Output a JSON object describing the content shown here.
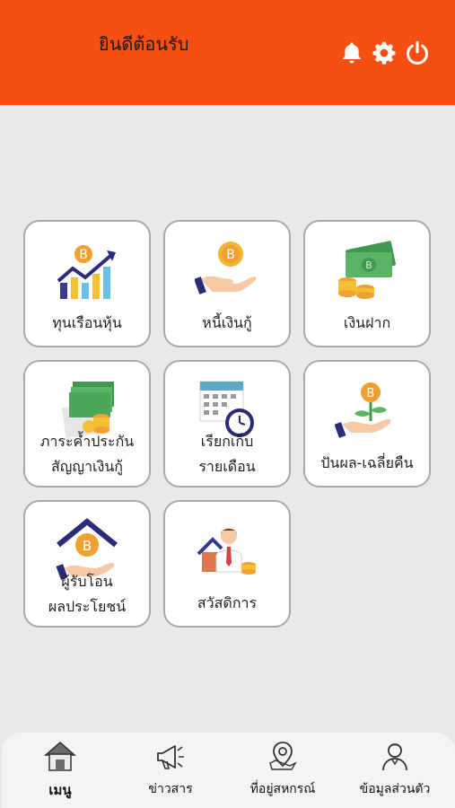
{
  "header": {
    "title": "ยินดีต้อนรับ",
    "icons": [
      "bell-icon",
      "gear-icon",
      "power-icon"
    ]
  },
  "menu": {
    "tiles": [
      {
        "lines": [
          "ทุนเรือนหุ้น"
        ],
        "icon": "bitcoin-chart-icon"
      },
      {
        "lines": [
          "หนี้เงินกู้"
        ],
        "icon": "coin-hand-icon"
      },
      {
        "lines": [
          "เงินฝาก"
        ],
        "icon": "money-coins-icon"
      },
      {
        "lines": [
          "ภาระค้ำประกัน",
          "สัญญาเงินกู้"
        ],
        "icon": "document-money-icon"
      },
      {
        "lines": [
          "เรียกเก็บ",
          "รายเดือน"
        ],
        "icon": "calendar-clock-icon"
      },
      {
        "lines": [
          "ปันผล-เฉลี่ยคืน"
        ],
        "icon": "plant-coin-icon"
      },
      {
        "lines": [
          "ผู้รับโอน",
          "ผลประโยชน์"
        ],
        "icon": "house-coin-icon"
      },
      {
        "lines": [
          "สวัสดิการ"
        ],
        "icon": "person-welfare-icon"
      }
    ]
  },
  "nav": {
    "items": [
      {
        "label": "เมนู",
        "icon": "home-icon",
        "active": true
      },
      {
        "label": "ข่าวสาร",
        "icon": "megaphone-icon",
        "active": false
      },
      {
        "label": "ที่อยู่สหกรณ์",
        "icon": "map-pin-icon",
        "active": false
      },
      {
        "label": "ข้อมูลส่วนตัว",
        "icon": "user-icon",
        "active": false
      }
    ]
  },
  "colors": {
    "accent": "#f64f12",
    "background": "#e9e9ea"
  }
}
